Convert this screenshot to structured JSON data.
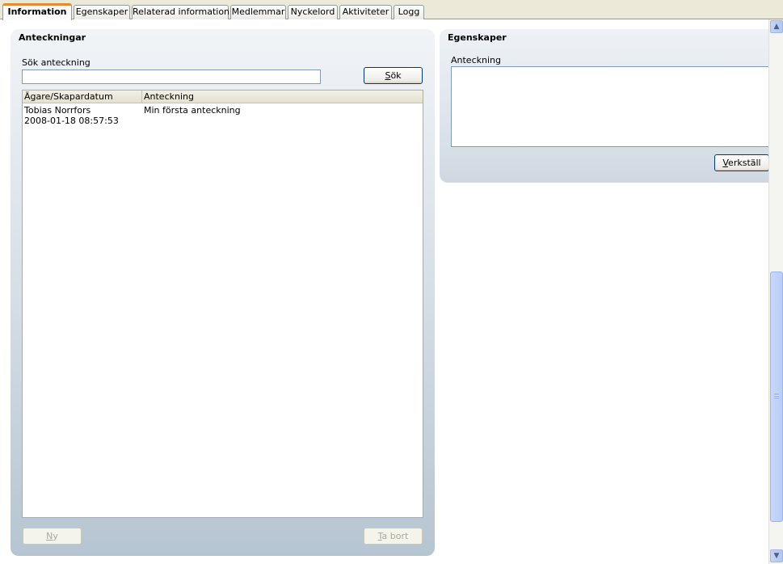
{
  "tabs": [
    {
      "label": "Information",
      "active": true
    },
    {
      "label": "Egenskaper",
      "active": false
    },
    {
      "label": "Relaterad information",
      "active": false
    },
    {
      "label": "Medlemmar",
      "active": false
    },
    {
      "label": "Nyckelord",
      "active": false
    },
    {
      "label": "Aktiviteter",
      "active": false
    },
    {
      "label": "Logg",
      "active": false
    }
  ],
  "left_panel": {
    "title": "Anteckningar",
    "search_label": "Sök anteckning",
    "search_value": "",
    "search_button": {
      "accel": "S",
      "rest": "ök"
    },
    "columns": [
      "Ägare/Skapardatum",
      "Anteckning"
    ],
    "rows": [
      {
        "owner": "Tobias Norrfors",
        "date": "2008-01-18 08:57:53",
        "note": "Min första anteckning"
      }
    ],
    "new_button": {
      "accel": "N",
      "rest": "y",
      "enabled": false
    },
    "delete_button": {
      "accel": "T",
      "rest": "a bort",
      "enabled": false
    }
  },
  "right_panel": {
    "title": "Egenskaper",
    "note_label": "Anteckning",
    "note_value": "",
    "apply_button": {
      "accel": "V",
      "rest": "erkställ"
    }
  },
  "scrollbar": {
    "up_icon": "arrow-up-icon",
    "down_icon": "arrow-down-icon"
  },
  "colors": {
    "active_tab_accent": "#e68b2c",
    "button_border": "#003c74",
    "panel_blue": "#b6c5d2"
  }
}
